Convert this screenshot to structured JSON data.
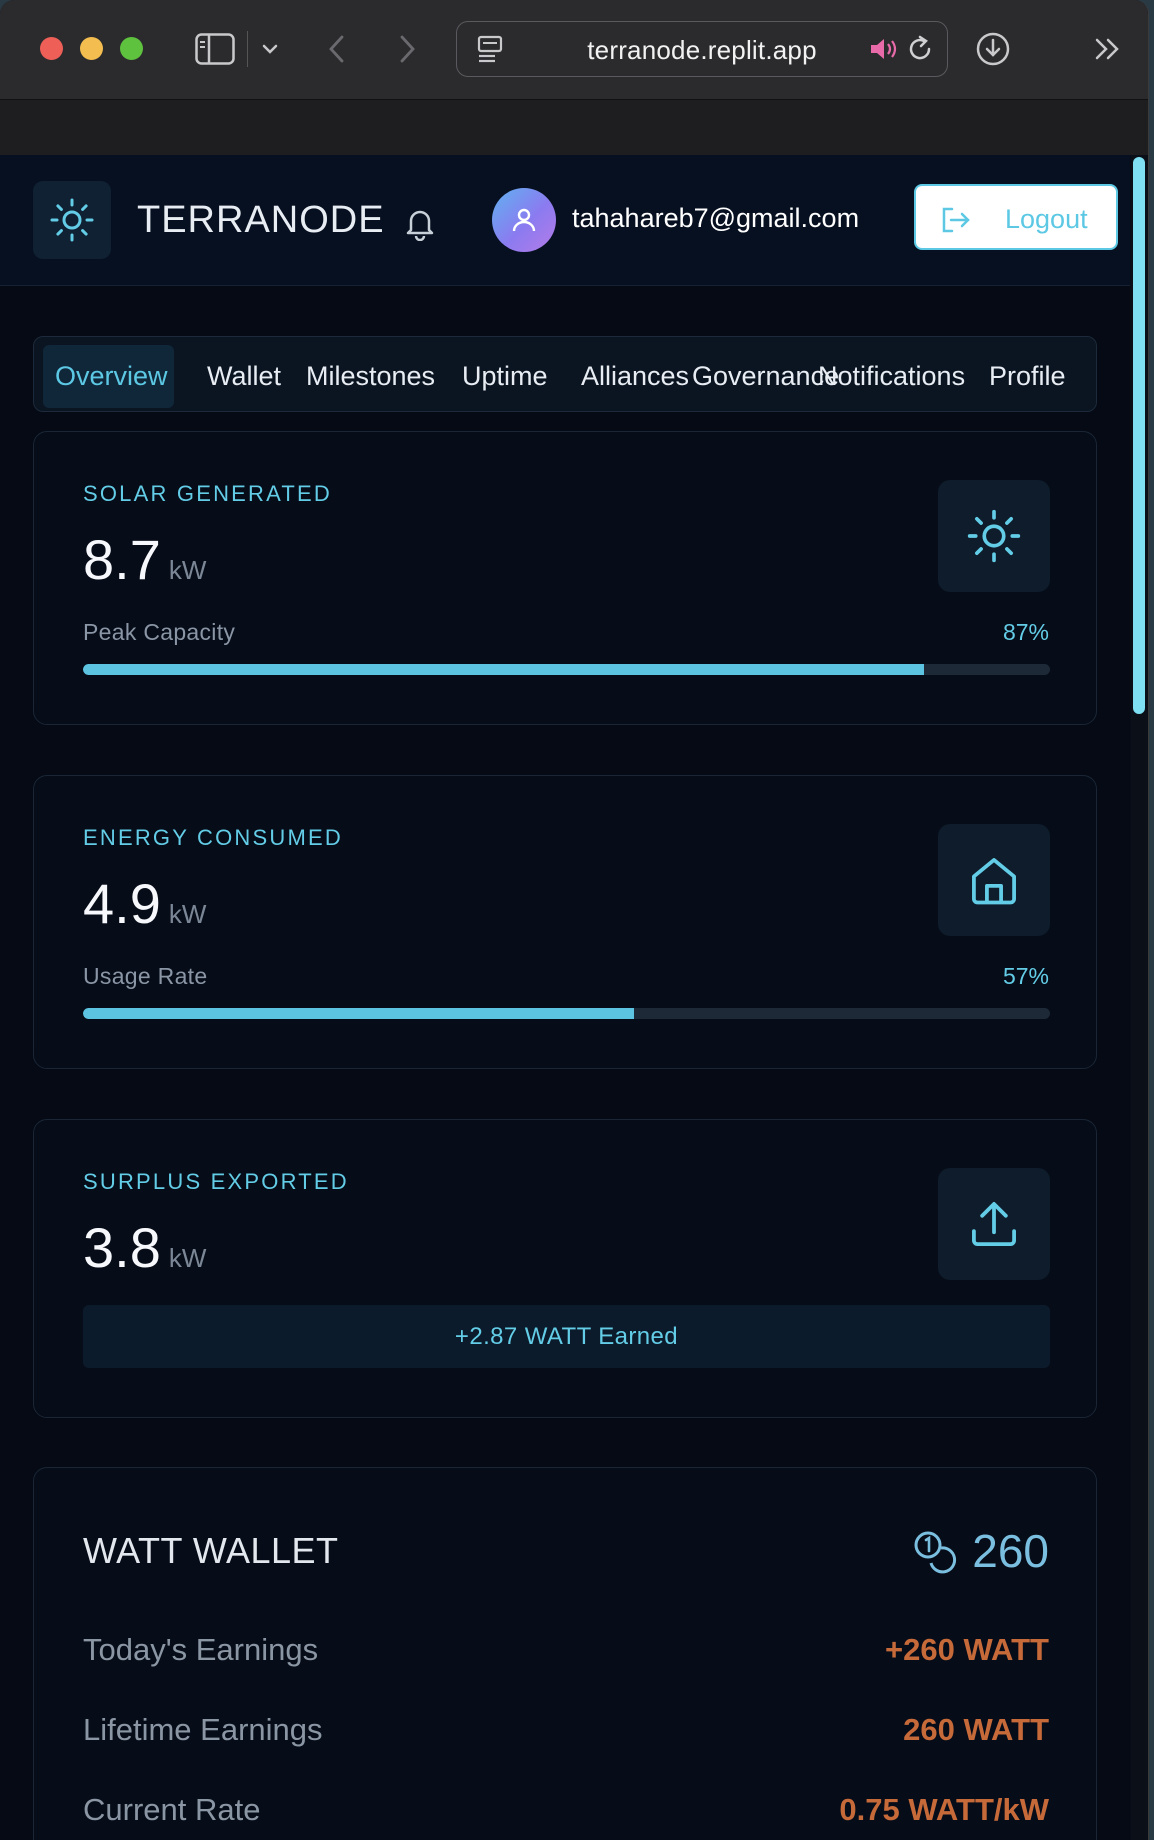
{
  "browser": {
    "url": "terranode.replit.app",
    "icons": [
      "sidebar-toggle-icon",
      "chevron-down-icon",
      "back-arrow-icon",
      "forward-arrow-icon",
      "page-icon",
      "speaker-icon",
      "reload-icon",
      "download-icon",
      "double-chevron-icon"
    ]
  },
  "header": {
    "brand": "TERRANODE",
    "email": "tahahareb7@gmail.com",
    "logout_label": "Logout"
  },
  "tabs": [
    {
      "label": "Overview",
      "active": true
    },
    {
      "label": "Wallet"
    },
    {
      "label": "Milestones"
    },
    {
      "label": "Uptime"
    },
    {
      "label": "Alliances"
    },
    {
      "label": "Governance"
    },
    {
      "label": "Notifications"
    },
    {
      "label": "Profile"
    }
  ],
  "cards": {
    "solar": {
      "label": "SOLAR GENERATED",
      "value": "8.7",
      "unit": "kW",
      "meta_label": "Peak Capacity",
      "meta_value": "87%",
      "progress": 0.87,
      "icon": "sun-icon"
    },
    "consumed": {
      "label": "ENERGY CONSUMED",
      "value": "4.9",
      "unit": "kW",
      "meta_label": "Usage Rate",
      "meta_value": "57%",
      "progress": 0.57,
      "icon": "home-icon"
    },
    "surplus": {
      "label": "SURPLUS EXPORTED",
      "value": "3.8",
      "unit": "kW",
      "earned": "+2.87 WATT Earned",
      "icon": "upload-icon"
    }
  },
  "wallet": {
    "title": "WATT WALLET",
    "balance": "260",
    "rows": [
      {
        "label": "Today's Earnings",
        "value": "+260 WATT"
      },
      {
        "label": "Lifetime Earnings",
        "value": "260 WATT"
      },
      {
        "label": "Current Rate",
        "value": "0.75 WATT/kW"
      }
    ]
  },
  "colors": {
    "accent": "#5cc8e4",
    "page_bg": "#050a14",
    "earnings": "#c76a3a"
  }
}
